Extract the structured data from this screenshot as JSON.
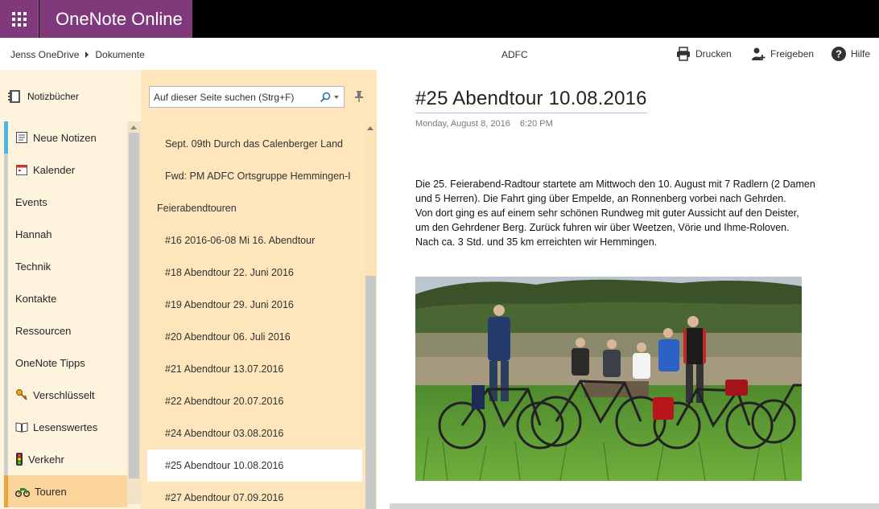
{
  "app": {
    "title": "OneNote Online"
  },
  "breadcrumb": {
    "owner": "Jenss OneDrive",
    "folder": "Dokumente"
  },
  "document": {
    "title": "ADFC"
  },
  "commands": {
    "print": "Drucken",
    "share": "Freigeben",
    "help": "Hilfe"
  },
  "notebooks": {
    "label": "Notizbücher"
  },
  "sections": [
    {
      "label": "Neue Notizen",
      "icon": "notes-icon",
      "color": "#4db6e2"
    },
    {
      "label": "Kalender",
      "icon": "calendar-icon",
      "color": "#cfcfcf"
    },
    {
      "label": "Events",
      "icon": "",
      "color": "#cfcfcf"
    },
    {
      "label": "Hannah",
      "icon": "",
      "color": "#cfcfcf"
    },
    {
      "label": "Technik",
      "icon": "",
      "color": "#cfcfcf"
    },
    {
      "label": "Kontakte",
      "icon": "",
      "color": "#cfcfcf"
    },
    {
      "label": "Ressourcen",
      "icon": "",
      "color": "#cfcfcf"
    },
    {
      "label": "OneNote Tipps",
      "icon": "",
      "color": "#cfcfcf"
    },
    {
      "label": "Verschlüsselt",
      "icon": "key-icon",
      "color": "#cfcfcf"
    },
    {
      "label": "Lesenswertes",
      "icon": "book-icon",
      "color": "#cfcfcf"
    },
    {
      "label": "Verkehr",
      "icon": "traffic-light-icon",
      "color": "#cfcfcf"
    },
    {
      "label": "Touren",
      "icon": "motorbike-icon",
      "color": "#f2a23a",
      "active": true
    }
  ],
  "search": {
    "placeholder": "Auf dieser Seite suchen (Strg+F)"
  },
  "pages": [
    {
      "label": "Sept. 09th Durch das Calenberger Land",
      "type": "page"
    },
    {
      "label": "Fwd: PM ADFC Ortsgruppe Hemmingen-I",
      "type": "page"
    },
    {
      "label": "Feierabendtouren",
      "type": "group"
    },
    {
      "label": "#16 2016-06-08 Mi 16. Abendtour",
      "type": "page"
    },
    {
      "label": "#18 Abendtour 22. Juni 2016",
      "type": "page"
    },
    {
      "label": "#19 Abendtour 29. Juni 2016",
      "type": "page"
    },
    {
      "label": "#20 Abendtour 06. Juli 2016",
      "type": "page"
    },
    {
      "label": "#21 Abendtour 13.07.2016",
      "type": "page"
    },
    {
      "label": "#22 Abendtour 20.07.2016",
      "type": "page"
    },
    {
      "label": "#24 Abendtour 03.08.2016",
      "type": "page"
    },
    {
      "label": "#25 Abendtour 10.08.2016",
      "type": "page",
      "active": true
    },
    {
      "label": "#27 Abendtour 07.09.2016",
      "type": "page"
    }
  ],
  "page": {
    "title": "#25 Abendtour 10.08.2016",
    "date": "Monday, August 8, 2016",
    "time": "6:20 PM",
    "paragraph_lines": [
      "Die 25. Feierabend-Radtour startete am Mittwoch den 10. August mit 7 Radlern (2 Damen",
      "und 5 Herren). Die Fahrt ging über Empelde, an Ronnenberg vorbei nach Gehrden.",
      "Von dort ging es auf einem sehr schönen Rundweg mit guter Aussicht auf den Deister,",
      "um den Gehrdener Berg. Zurück fuhren wir über Weetzen, Vörie und Ihme-Roloven.",
      "Nach ca. 3 Std. und 35 km erreichten wir Hemmingen."
    ]
  },
  "colors": {
    "brand": "#80397b",
    "rail_bg": "#fef4de",
    "pages_bg": "#fee5bc",
    "active_section": "#fcd59c"
  }
}
